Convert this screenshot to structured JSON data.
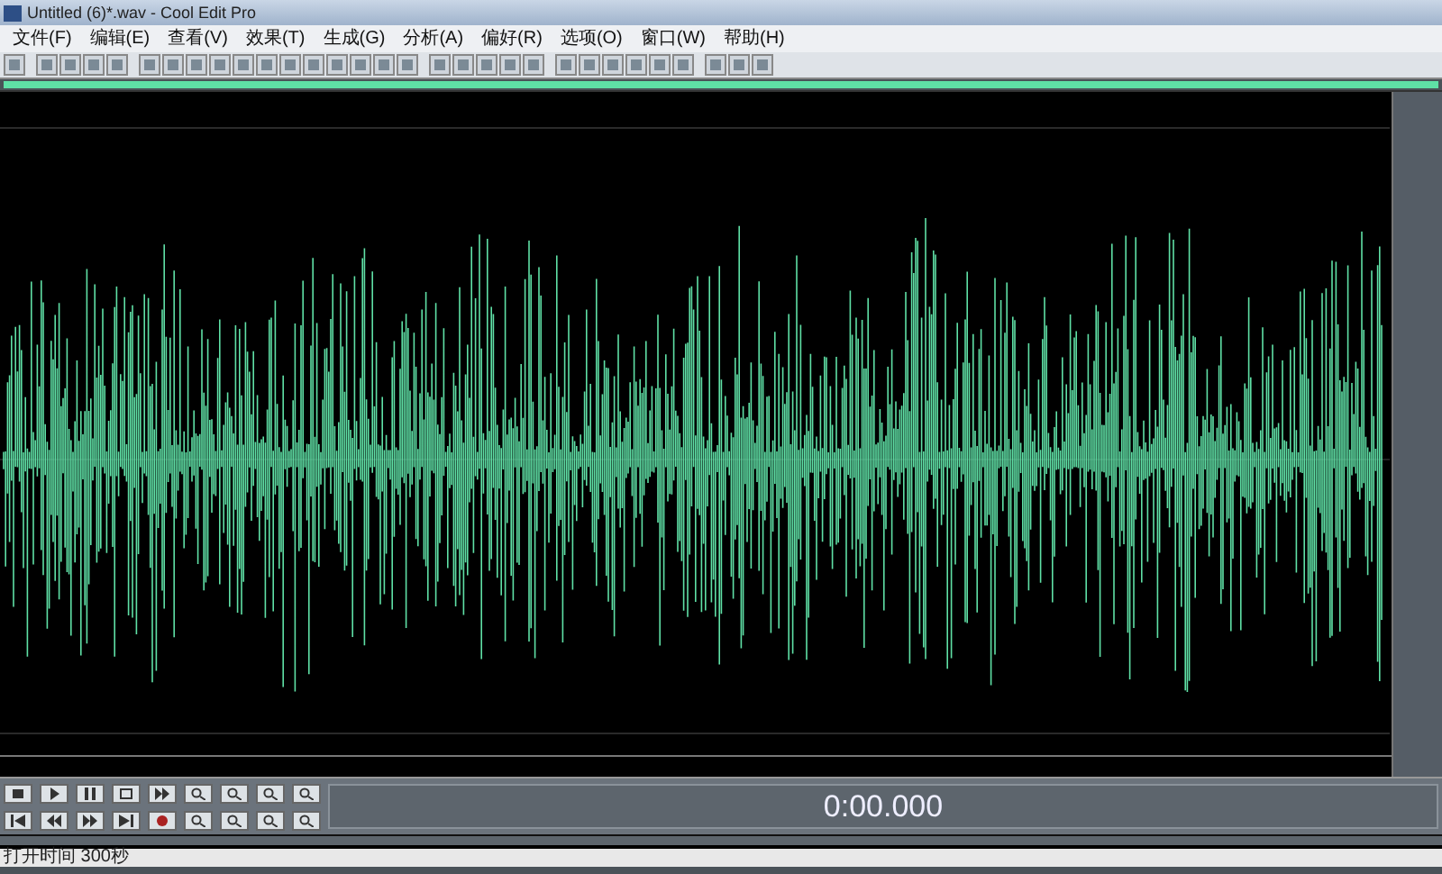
{
  "window": {
    "title": "Untitled (6)*.wav - Cool Edit Pro"
  },
  "menu": [
    "文件(F)",
    "编辑(E)",
    "查看(V)",
    "效果(T)",
    "生成(G)",
    "分析(A)",
    "偏好(R)",
    "选项(O)",
    "窗口(W)",
    "帮助(H)"
  ],
  "transport": {
    "time": "0:00.000"
  },
  "status_bar": {
    "left": "打开时间 300秒"
  }
}
